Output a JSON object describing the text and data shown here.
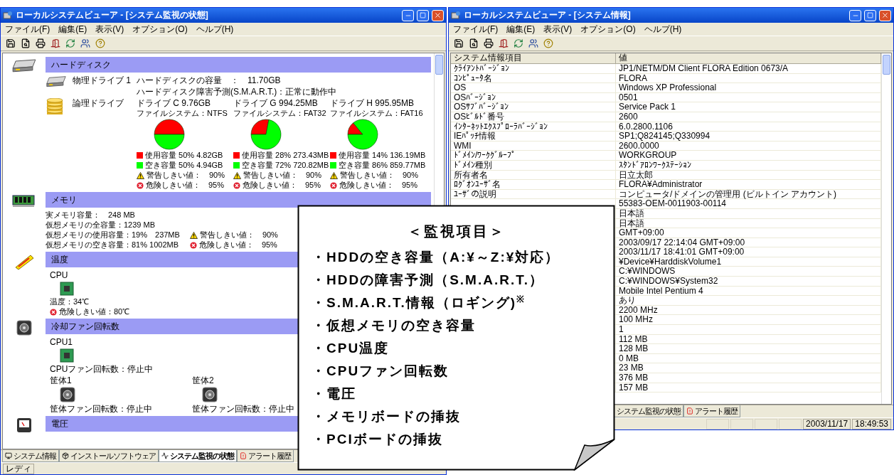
{
  "monitor": {
    "title": "ローカルシステムビューア - [システム監視の状態]",
    "menu": [
      "ファイル(F)",
      "編集(E)",
      "表示(V)",
      "オプション(O)",
      "ヘルプ(H)"
    ],
    "sections": [
      {
        "kind": "disk",
        "title": "ハードディスク",
        "physical_label": "物理ドライブ 1",
        "physical_lines": [
          "ハードディスクの容量　：　11.70GB",
          "ハードディスク障害予測(S.M.A.R.T.)：正常に動作中"
        ],
        "logical_label": "論理ドライブ",
        "drives": [
          {
            "title": "ドライブ C 9.76GB",
            "fs": "ファイルシステム：NTFS",
            "chart_data": {
              "type": "pie",
              "values": [
                50,
                50
              ]
            },
            "legend": [
              {
                "kind": "swatch",
                "color": "#ff0000",
                "text": "使用容量 50% 4.82GB"
              },
              {
                "kind": "swatch",
                "color": "#00ff00",
                "text": "空き容量 50% 4.94GB"
              },
              {
                "kind": "warning",
                "text": "警告しきい値：　90%"
              },
              {
                "kind": "danger",
                "text": "危険しきい値：　95%"
              }
            ]
          },
          {
            "title": "ドライブ G 994.25MB",
            "fs": "ファイルシステム：FAT32",
            "chart_data": {
              "type": "pie",
              "values": [
                28,
                72
              ]
            },
            "legend": [
              {
                "kind": "swatch",
                "color": "#ff0000",
                "text": "使用容量 28% 273.43MB"
              },
              {
                "kind": "swatch",
                "color": "#00ff00",
                "text": "空き容量 72% 720.82MB"
              },
              {
                "kind": "warning",
                "text": "警告しきい値：　90%"
              },
              {
                "kind": "danger",
                "text": "危険しきい値：　95%"
              }
            ]
          },
          {
            "title": "ドライブ H 995.95MB",
            "fs": "ファイルシステム：FAT16",
            "chart_data": {
              "type": "pie",
              "values": [
                14,
                86
              ]
            },
            "legend": [
              {
                "kind": "swatch",
                "color": "#ff0000",
                "text": "使用容量 14% 136.19MB"
              },
              {
                "kind": "swatch",
                "color": "#00ff00",
                "text": "空き容量 86% 859.77MB"
              },
              {
                "kind": "warning",
                "text": "警告しきい値：　90%"
              },
              {
                "kind": "danger",
                "text": "危険しきい値：　95%"
              }
            ]
          }
        ]
      },
      {
        "kind": "memory",
        "title": "メモリ",
        "lines": [
          "実メモリ容量：　248 MB",
          "仮想メモリの全容量：1239 MB",
          "仮想メモリの使用容量：19%　237MB",
          "仮想メモリの空き容量：81% 1002MB"
        ],
        "thresholds": [
          {
            "kind": "warning",
            "text": "警告しきい値：　90%"
          },
          {
            "kind": "danger",
            "text": "危険しきい値：　95%"
          }
        ]
      },
      {
        "kind": "temperature",
        "title": "温度",
        "device": "CPU",
        "reading": "温度：34℃",
        "thresholds": [
          {
            "kind": "danger",
            "text": "危険しきい値：80℃"
          }
        ]
      },
      {
        "kind": "fan",
        "title": "冷却ファン回転数",
        "device": "CPU1",
        "reading": "CPUファン回転数：停止中",
        "cases": [
          {
            "label": "筐体1",
            "reading": "筐体ファン回転数：停止中"
          },
          {
            "label": "筐体2",
            "reading": "筐体ファン回転数：停止中"
          }
        ]
      },
      {
        "kind": "voltage",
        "title": "電圧"
      }
    ],
    "tabs": [
      {
        "label": "システム情報",
        "selected": false
      },
      {
        "label": "インストールソフトウェア",
        "selected": false
      },
      {
        "label": "システム監視の状態",
        "selected": true
      },
      {
        "label": "アラート履歴",
        "selected": false
      }
    ],
    "status": "レディ"
  },
  "info": {
    "title": "ローカルシステムビューア - [システム情報]",
    "menu": [
      "ファイル(F)",
      "編集(E)",
      "表示(V)",
      "オプション(O)",
      "ヘルプ(H)"
    ],
    "columns": [
      "システム情報項目",
      "値"
    ],
    "rows": [
      {
        "name": "ｸﾗｲｱﾝﾄﾊﾞｰｼﾞｮﾝ",
        "value": "JP1/NETM/DM Client FLORA Edition 0673/A"
      },
      {
        "name": "ｺﾝﾋﾟｭｰﾀ名",
        "value": "FLORA"
      },
      {
        "name": "OS",
        "value": "Windows XP Professional"
      },
      {
        "name": "OSﾊﾞｰｼﾞｮﾝ",
        "value": "0501"
      },
      {
        "name": "OSｻﾌﾞﾊﾞｰｼﾞｮﾝ",
        "value": "Service Pack 1"
      },
      {
        "name": "OSﾋﾞﾙﾄﾞ番号",
        "value": "2600"
      },
      {
        "name": "ｲﾝﾀｰﾈｯﾄｴｸｽﾌﾟﾛｰﾗﾊﾞｰｼﾞｮﾝ",
        "value": "6.0.2800.1106"
      },
      {
        "name": "IEﾊﾟｯﾁ情報",
        "value": "SP1;Q824145;Q330994"
      },
      {
        "name": "WMI",
        "value": "2600.0000"
      },
      {
        "name": "ﾄﾞﾒｲﾝ/ﾜｰｸｸﾞﾙｰﾌﾟ",
        "value": "WORKGROUP"
      },
      {
        "name": "ﾄﾞﾒｲﾝ種別",
        "value": "ｽﾀﾝﾄﾞｱﾛﾝﾜｰｸｽﾃｰｼｮﾝ"
      },
      {
        "name": "所有者名",
        "value": "日立太郎"
      },
      {
        "name": "ﾛｸﾞｵﾝﾕｰｻﾞ名",
        "value": "FLORA¥Administrator"
      },
      {
        "name": "ﾕｰｻﾞの説明",
        "value": "コンピュータ/ドメインの管理用 (ビルトイン アカウント)"
      },
      {
        "value": "55383-OEM-0011903-00114"
      },
      {
        "value": "日本語"
      },
      {
        "value": "日本語"
      },
      {
        "value": "GMT+09:00"
      },
      {
        "value": "2003/09/17 22:14:04 GMT+09:00"
      },
      {
        "value": "2003/11/17 18:41:01 GMT+09:00"
      },
      {
        "value": "¥Device¥HarddiskVolume1"
      },
      {
        "value": "C:¥WINDOWS"
      },
      {
        "value": "C:¥WINDOWS¥System32"
      },
      {
        "value": "Mobile Intel Pentium 4"
      },
      {
        "value": "あり"
      },
      {
        "value": "2200 MHz"
      },
      {
        "value": "100 MHz"
      },
      {
        "value": "1"
      },
      {
        "value": "112 MB"
      },
      {
        "value": "128 MB"
      },
      {
        "value": "0 MB"
      },
      {
        "value": "23 MB"
      },
      {
        "value": "376 MB"
      },
      {
        "value": "157 MB"
      }
    ],
    "tabs": [
      {
        "label": "システム監視の状態",
        "selected": false
      },
      {
        "label": "アラート履歴",
        "selected": false
      }
    ],
    "status": [
      "2003/11/17",
      "18:49:53"
    ]
  },
  "callout": {
    "heading": "＜監視項目＞",
    "items": [
      "・HDDの空き容量（A:¥～Z:¥対応）",
      "・HDDの障害予測（S.M.A.R.T.）",
      "・S.M.A.R.T.情報（ロギング)$^{※}$",
      "・仮想メモリの空き容量",
      "・CPU温度",
      "・CPUファン回転数",
      "・電圧",
      "・メモリボードの挿抜",
      "・PCIボードの挿抜"
    ]
  }
}
